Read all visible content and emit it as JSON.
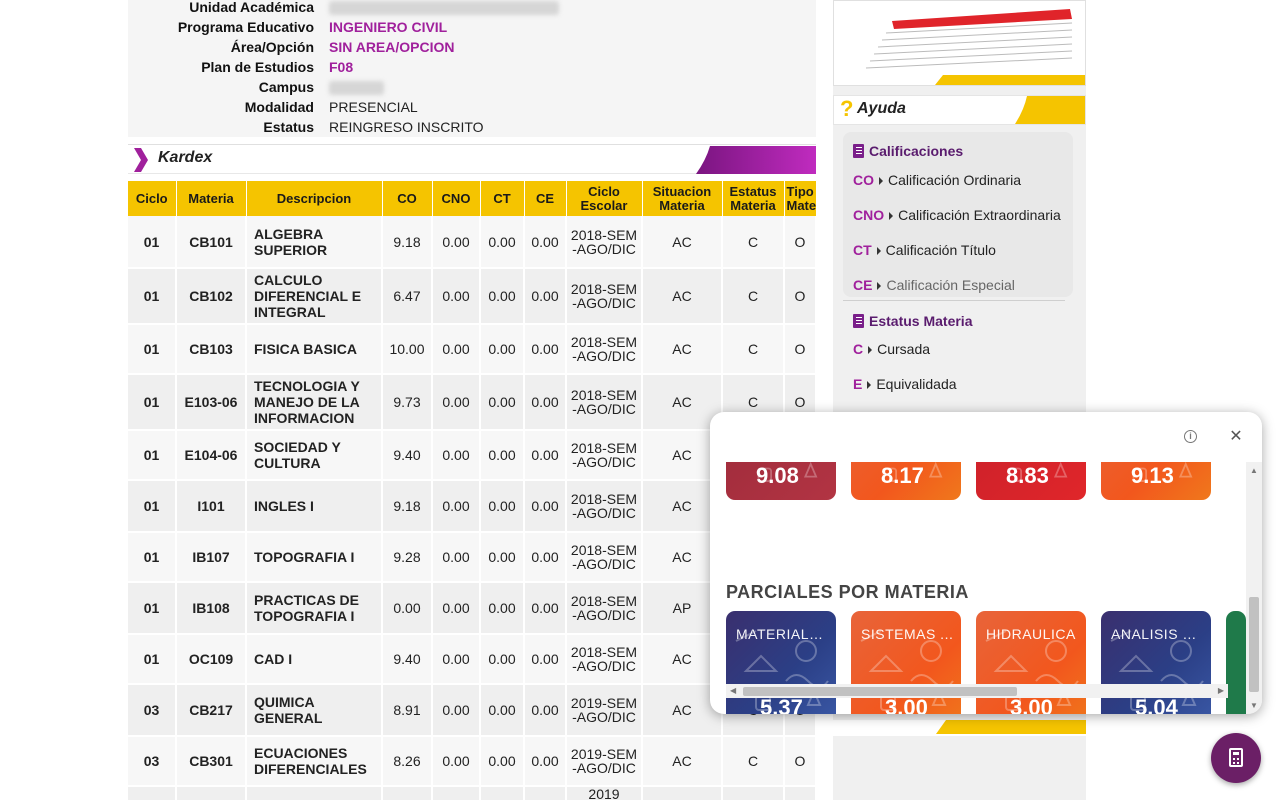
{
  "info": [
    {
      "label": "Unidad Académica",
      "value": "",
      "style": "blurred"
    },
    {
      "label": "Programa Educativo",
      "value": "INGENIERO CIVIL",
      "style": "purple"
    },
    {
      "label": "Área/Opción",
      "value": "SIN AREA/OPCION",
      "style": "purple"
    },
    {
      "label": "Plan de Estudios",
      "value": "F08",
      "style": "purple"
    },
    {
      "label": "Campus",
      "value": "",
      "style": "blurred"
    },
    {
      "label": "Modalidad",
      "value": "PRESENCIAL",
      "style": "plain"
    },
    {
      "label": "Estatus",
      "value": "REINGRESO INSCRITO",
      "style": "plain"
    }
  ],
  "kardex": {
    "title": "Kardex",
    "columns": [
      "Ciclo",
      "Materia",
      "Descripcion",
      "CO",
      "CNO",
      "CT",
      "CE",
      "Ciclo Escolar",
      "Situacion Materia",
      "Estatus Materia",
      "Tipo Materia"
    ],
    "rows": [
      [
        "01",
        "CB101",
        "ALGEBRA SUPERIOR",
        "9.18",
        "0.00",
        "0.00",
        "0.00",
        "2018-SEM-AGO/DIC",
        "AC",
        "C",
        "O"
      ],
      [
        "01",
        "CB102",
        "CALCULO DIFERENCIAL E INTEGRAL",
        "6.47",
        "0.00",
        "0.00",
        "0.00",
        "2018-SEM-AGO/DIC",
        "AC",
        "C",
        "O"
      ],
      [
        "01",
        "CB103",
        "FISICA BASICA",
        "10.00",
        "0.00",
        "0.00",
        "0.00",
        "2018-SEM-AGO/DIC",
        "AC",
        "C",
        "O"
      ],
      [
        "01",
        "E103-06",
        "TECNOLOGIA Y MANEJO DE LA INFORMACION",
        "9.73",
        "0.00",
        "0.00",
        "0.00",
        "2018-SEM-AGO/DIC",
        "AC",
        "C",
        "O"
      ],
      [
        "01",
        "E104-06",
        "SOCIEDAD Y CULTURA",
        "9.40",
        "0.00",
        "0.00",
        "0.00",
        "2018-SEM-AGO/DIC",
        "AC",
        "C",
        "O"
      ],
      [
        "01",
        "I101",
        "INGLES I",
        "9.18",
        "0.00",
        "0.00",
        "0.00",
        "2018-SEM-AGO/DIC",
        "AC",
        "C",
        "O"
      ],
      [
        "01",
        "IB107",
        "TOPOGRAFIA I",
        "9.28",
        "0.00",
        "0.00",
        "0.00",
        "2018-SEM-AGO/DIC",
        "AC",
        "C",
        "O"
      ],
      [
        "01",
        "IB108",
        "PRACTICAS DE TOPOGRAFIA I",
        "0.00",
        "0.00",
        "0.00",
        "0.00",
        "2018-SEM-AGO/DIC",
        "AP",
        "C",
        "O"
      ],
      [
        "01",
        "OC109",
        "CAD I",
        "9.40",
        "0.00",
        "0.00",
        "0.00",
        "2018-SEM-AGO/DIC",
        "AC",
        "C",
        "O"
      ],
      [
        "03",
        "CB217",
        "QUIMICA GENERAL",
        "8.91",
        "0.00",
        "0.00",
        "0.00",
        "2019-SEM-AGO/DIC",
        "AC",
        "C",
        "O"
      ],
      [
        "03",
        "CB301",
        "ECUACIONES DIFERENCIALES",
        "8.26",
        "0.00",
        "0.00",
        "0.00",
        "2019-SEM-AGO/DIC",
        "AC",
        "C",
        "O"
      ],
      [
        "",
        "",
        "",
        "",
        "",
        "",
        "",
        "2019",
        "",
        "",
        ""
      ]
    ]
  },
  "ayuda": {
    "title": "Ayuda",
    "calificaciones_title": "Calificaciones",
    "calificaciones": [
      {
        "code": "CO",
        "text": "Calificación Ordinaria"
      },
      {
        "code": "CNO",
        "text": "Calificación Extraordinaria"
      },
      {
        "code": "CT",
        "text": "Calificación Título"
      },
      {
        "code": "CE",
        "text": "Calificación Especial"
      }
    ],
    "estatus_title": "Estatus Materia",
    "estatus": [
      {
        "code": "C",
        "text": "Cursada"
      },
      {
        "code": "E",
        "text": "Equivalidada"
      }
    ]
  },
  "popup": {
    "info_icon": "info-icon",
    "close_icon": "close-icon",
    "top_values": [
      "9.08",
      "8.17",
      "8.83",
      "9.13"
    ],
    "section_title": "PARCIALES POR MATERIA",
    "tiles": [
      {
        "label": "MATERIALE...",
        "value": "5.37",
        "theme": "blue"
      },
      {
        "label": "SISTEMAS ...",
        "value": "3.00",
        "theme": "orange"
      },
      {
        "label": "HIDRAULICA",
        "value": "3.00",
        "theme": "orange"
      },
      {
        "label": "ANALISIS E...",
        "value": "5.04",
        "theme": "blue"
      }
    ]
  },
  "fab": {
    "icon": "calculator-icon"
  },
  "colors": {
    "accent_purple": "#a0209c",
    "header_gold": "#f5c400",
    "fab_purple": "#6b1f66",
    "tile_blue": "#2b3f86",
    "tile_orange": "#f2571d",
    "tile_red": "#d9232a"
  }
}
